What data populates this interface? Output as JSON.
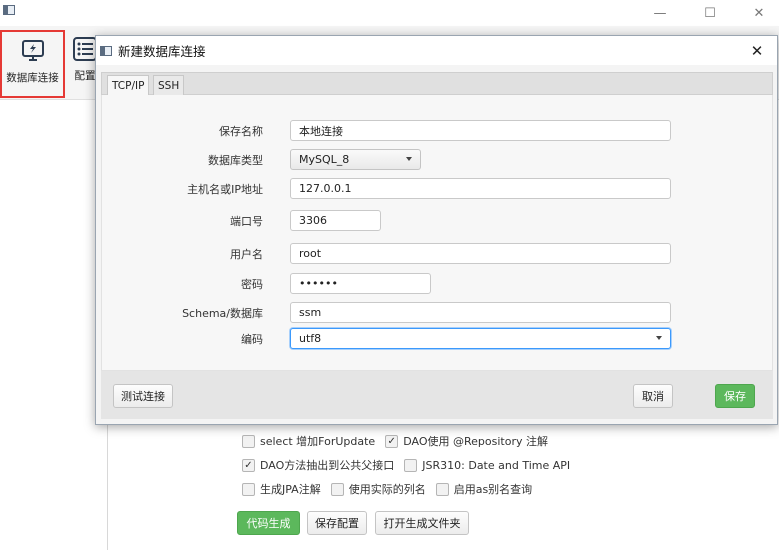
{
  "window": {
    "minimize": "—",
    "maximize": "☐",
    "close": "✕"
  },
  "toolbar": {
    "items": [
      {
        "label": "数据库连接",
        "icon": "monitor-plug-icon"
      },
      {
        "label": "配置",
        "icon": "list-config-icon"
      }
    ]
  },
  "options": {
    "row1": {
      "a": "select 增加ForUpdate",
      "a_checked": false,
      "b": "DAO使用 @Repository 注解",
      "b_checked": true
    },
    "row2": {
      "a": "DAO方法抽出到公共父接口",
      "a_checked": true,
      "b": "JSR310: Date and Time API",
      "b_checked": false
    },
    "row3": {
      "a": "生成JPA注解",
      "b": "使用实际的列名",
      "c": "启用as别名查询"
    },
    "buttons": {
      "generate": "代码生成",
      "save_config": "保存配置",
      "open_folder": "打开生成文件夹"
    }
  },
  "dialog": {
    "title": "新建数据库连接",
    "close": "✕",
    "tabs": [
      "TCP/IP",
      "SSH"
    ],
    "fields": {
      "name_label": "保存名称",
      "name_value": "本地连接",
      "dbtype_label": "数据库类型",
      "dbtype_value": "MySQL_8",
      "host_label": "主机名或IP地址",
      "host_value": "127.0.0.1",
      "port_label": "端口号",
      "port_value": "3306",
      "user_label": "用户名",
      "user_value": "root",
      "password_label": "密码",
      "password_value": "••••••",
      "schema_label": "Schema/数据库",
      "schema_value": "ssm",
      "encoding_label": "编码",
      "encoding_value": "utf8"
    },
    "footer": {
      "test": "测试连接",
      "cancel": "取消",
      "save": "保存"
    }
  }
}
